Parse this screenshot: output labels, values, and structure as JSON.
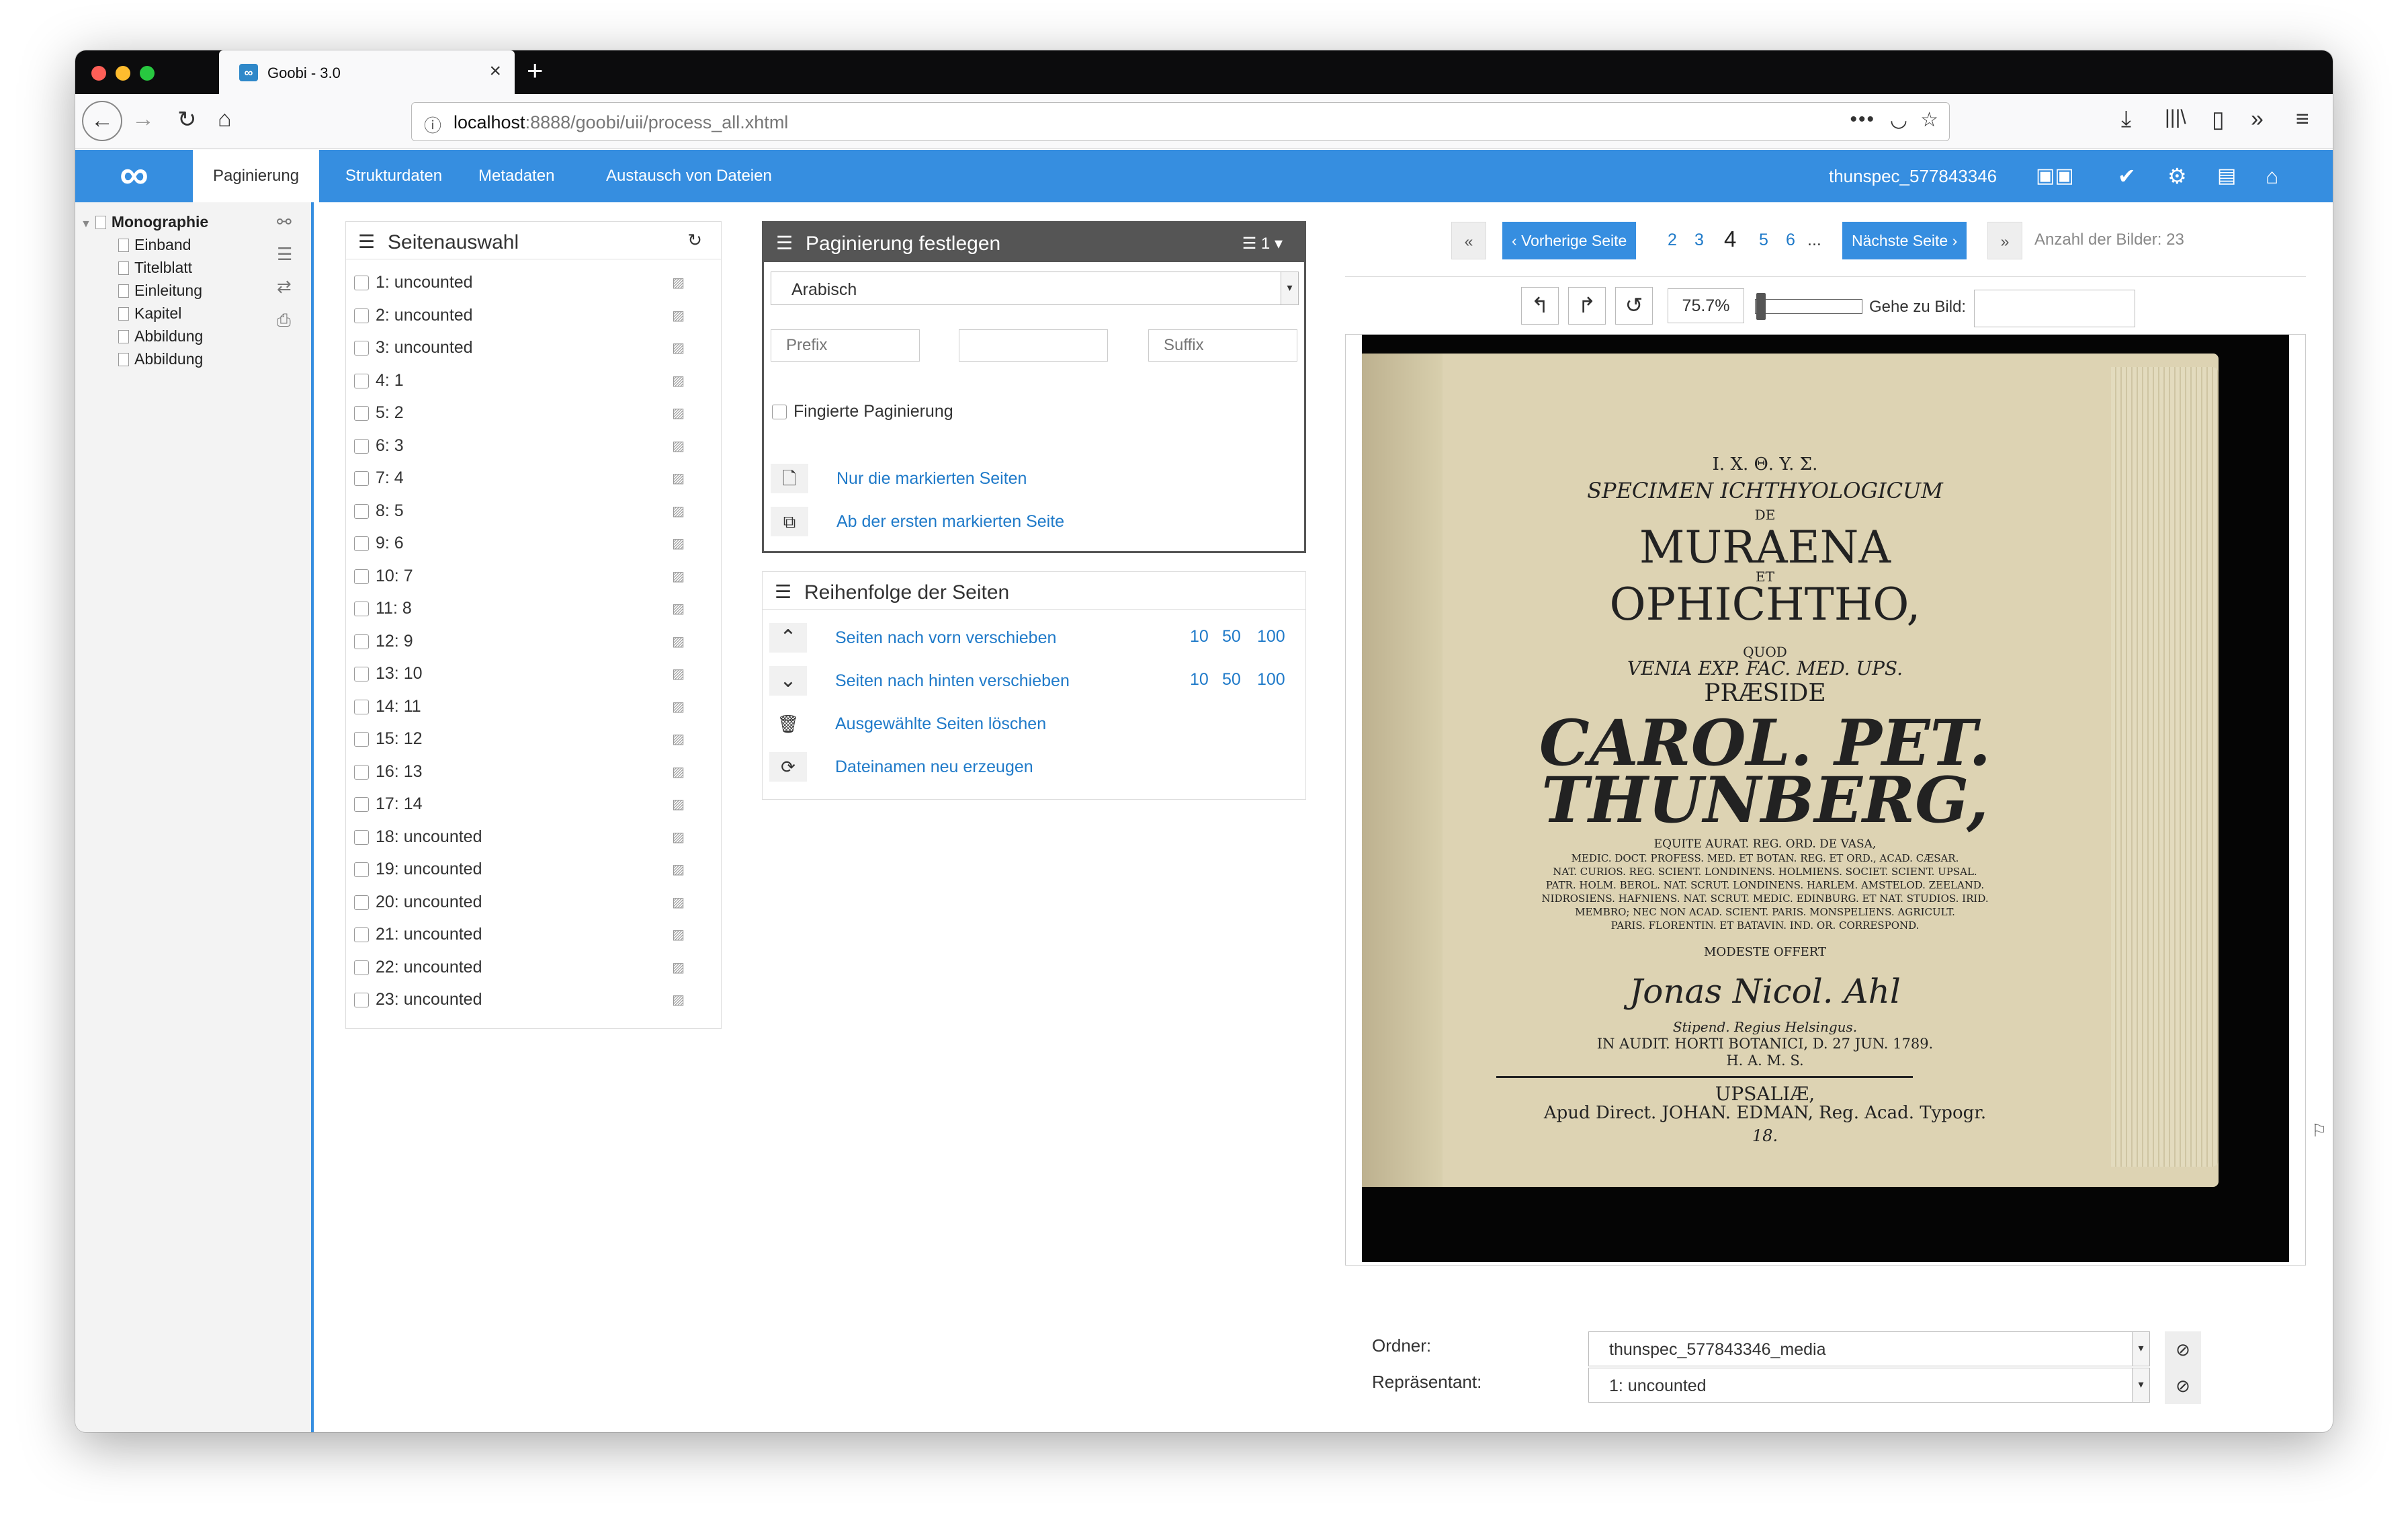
{
  "browser": {
    "tab_title": "Goobi - 3.0",
    "tab_favicon": "∞",
    "url_host": "localhost",
    "url_rest": ":8888/goobi/uii/process_all.xhtml"
  },
  "app": {
    "logo": "∞",
    "nav": [
      "Paginierung",
      "Strukturdaten",
      "Metadaten",
      "Austausch von Dateien"
    ],
    "process_id": "thunspec_577843346"
  },
  "tree": {
    "root": "Monographie",
    "children": [
      "Einband",
      "Titelblatt",
      "Einleitung",
      "Kapitel",
      "Abbildung",
      "Abbildung"
    ]
  },
  "seitenauswahl": {
    "title": "Seitenauswahl",
    "pages": [
      "1: uncounted",
      "2: uncounted",
      "3: uncounted",
      "4: 1",
      "5: 2",
      "6: 3",
      "7: 4",
      "8: 5",
      "9: 6",
      "10: 7",
      "11: 8",
      "12: 9",
      "13: 10",
      "14: 11",
      "15: 12",
      "16: 13",
      "17: 14",
      "18: uncounted",
      "19: uncounted",
      "20: uncounted",
      "21: uncounted",
      "22: uncounted",
      "23: uncounted"
    ]
  },
  "paginierung": {
    "title": "Paginierung festlegen",
    "count_label": "1",
    "type": "Arabisch",
    "prefix_placeholder": "Prefix",
    "suffix_placeholder": "Suffix",
    "fictitious": "Fingierte Paginierung",
    "only_marked": "Nur die markierten Seiten",
    "from_first_marked": "Ab der ersten markierten Seite"
  },
  "reihenfolge": {
    "title": "Reihenfolge der Seiten",
    "forward": "Seiten nach vorn verschieben",
    "backward": "Seiten nach hinten verschieben",
    "delete": "Ausgewählte Seiten löschen",
    "regen": "Dateinamen neu erzeugen",
    "steps": [
      "10",
      "50",
      "100"
    ]
  },
  "viewer": {
    "prev": "Vorherige Seite",
    "next": "Nächste Seite",
    "page_numbers": [
      "2",
      "3",
      "4",
      "5",
      "6",
      "..."
    ],
    "current_page": "4",
    "image_count": "Anzahl der Bilder: 23",
    "zoom": "75.7%",
    "zoom_level": 0.02,
    "goto_label": "Gehe zu Bild:"
  },
  "scan_text": {
    "l1": "I. X. Θ. Y. Σ.",
    "l2": "SPECIMEN ICHTHYOLOGICUM",
    "l3": "DE",
    "l4": "MURAENA",
    "l5": "ET",
    "l6": "OPHICHTHO,",
    "l7": "QUOD",
    "l8": "VENIA EXP. FAC. MED. UPS.",
    "l9": "PRÆSIDE",
    "l10": "CAROL. PET.",
    "l11": "THUNBERG,",
    "l12": "EQUITE AURAT. REG. ORD. DE VASA,",
    "l13": "MEDIC. DOCT. PROFESS. MED. ET BOTAN. REG. ET ORD., ACAD. CÆSAR.",
    "l14": "NAT. CURIOS. REG. SCIENT. LONDINENS. HOLMIENS. SOCIET. SCIENT. UPSAL.",
    "l15": "PATR. HOLM. BEROL. NAT. SCRUT. LONDINENS. HARLEM. AMSTELOD. ZEELAND.",
    "l16": "NIDROSIENS. HAFNIENS. NAT. SCRUT. MEDIC. EDINBURG. ET NAT. STUDIOS. IRID.",
    "l17": "MEMBRO; NEC NON ACAD. SCIENT. PARIS. MONSPELIENS. AGRICULT.",
    "l18": "PARIS. FLORENTIN. ET BATAVIN. IND. OR. CORRESPOND.",
    "l19": "MODESTE OFFERT",
    "l20": "Jonas Nicol. Ahl",
    "l21": "Stipend. Regius Helsingus.",
    "l22": "IN AUDIT. HORTI BOTANICI, D. 27 JUN. 1789.",
    "l23": "H. A. M. S.",
    "l24": "UPSALIÆ,",
    "l25": "Apud Direct. JOHAN. EDMAN, Reg. Acad. Typogr.",
    "l26": "18."
  },
  "form": {
    "folder_label": "Ordner:",
    "folder_value": "thunspec_577843346_media",
    "rep_label": "Repräsentant:",
    "rep_value": "1: uncounted"
  }
}
